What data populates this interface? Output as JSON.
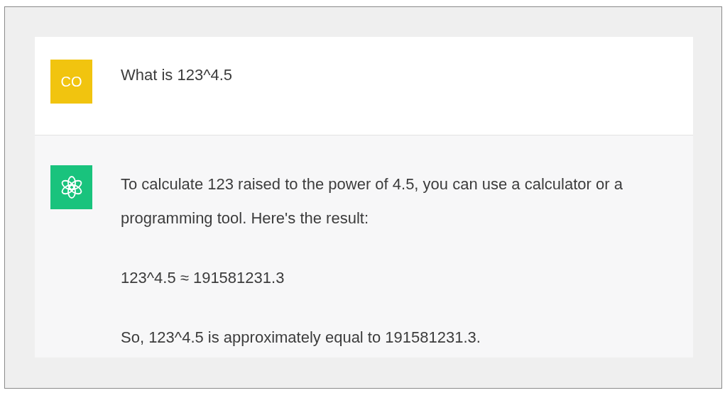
{
  "messages": [
    {
      "kind": "user",
      "avatar_text": "CO",
      "color": "#f1c40f",
      "paragraphs": [
        "What is 123^4.5"
      ]
    },
    {
      "kind": "assistant",
      "color": "#19c37d",
      "paragraphs": [
        "To calculate 123 raised to the power of 4.5, you can use a calculator or a programming tool. Here's the result:",
        "123^4.5 ≈ 191581231.3",
        "So, 123^4.5 is approximately equal to 191581231.3."
      ]
    }
  ]
}
